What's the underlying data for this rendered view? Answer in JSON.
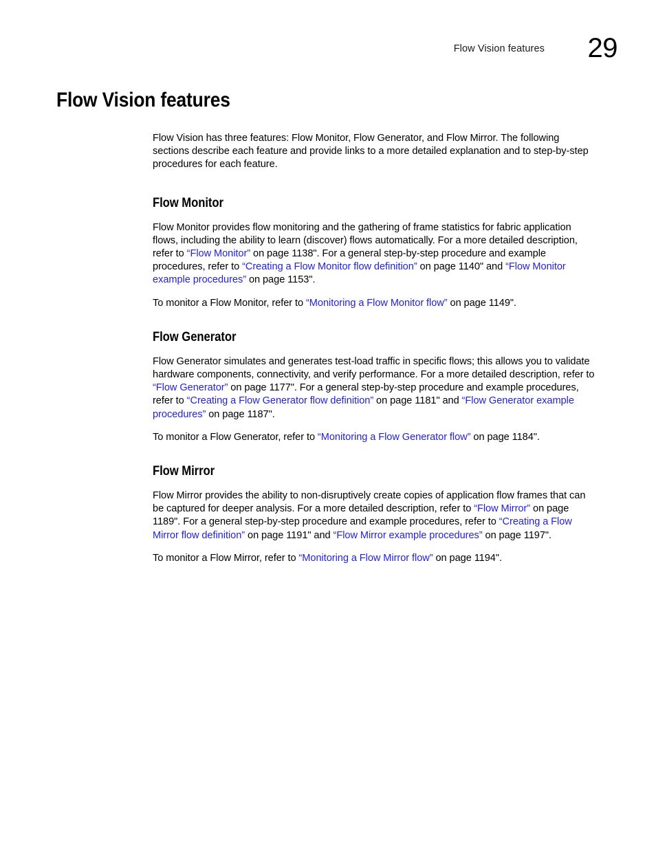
{
  "header": {
    "title": "Flow Vision features",
    "page_number": "29"
  },
  "colors": {
    "link": "#2222dd",
    "text": "#000000",
    "background": "#ffffff"
  },
  "chapter": {
    "title": "Flow Vision features",
    "intro": {
      "part1": "Flow Vision has three features: Flow Monitor, Flow Generator, and Flow Mirror. The following sections describe each feature and provide links to a more detailed explanation and to step-by-step procedures for each feature."
    }
  },
  "sections": [
    {
      "heading": "Flow Monitor",
      "paragraph1": {
        "t1": "Flow Monitor provides flow monitoring and the gathering of frame statistics for fabric application flows, including the ability to learn (discover) flows automatically. For a more detailed description, refer to ",
        "link1": "“Flow Monitor”",
        "t2": " on page 1138\".  For a general step-by-step procedure and example procedures, refer to ",
        "link2": "“Creating a Flow Monitor flow definition”",
        "t3": " on page 1140\" and ",
        "link3": "“Flow Monitor example procedures”",
        "t4": " on page 1153\"."
      },
      "paragraph2": {
        "t1": "To monitor a Flow Monitor, refer to ",
        "link1": "“Monitoring a Flow Monitor flow”",
        "t2": " on page 1149\"."
      }
    },
    {
      "heading": "Flow Generator",
      "paragraph1": {
        "t1": "Flow Generator simulates and generates test-load traffic in specific flows; this allows you to validate hardware components, connectivity, and verify performance. For a more detailed description, refer to ",
        "link1": "“Flow Generator”",
        "t2": " on page 1177\".  For a general step-by-step procedure and example procedures, refer to ",
        "link2": "“Creating a Flow Generator flow definition”",
        "t3": " on page 1181\" and ",
        "link3": "“Flow Generator example procedures”",
        "t4": " on page 1187\"."
      },
      "paragraph2": {
        "t1": "To monitor a Flow Generator, refer to ",
        "link1": "“Monitoring a Flow Generator flow”",
        "t2": " on page 1184\"."
      }
    },
    {
      "heading": "Flow Mirror",
      "paragraph1": {
        "t1": "Flow Mirror provides the ability to non-disruptively create copies of application flow frames that can be captured for deeper analysis. For a more detailed description, refer to ",
        "link1": "“Flow Mirror”",
        "t2": " on page 1189\". For a general step-by-step procedure and example procedures, refer to ",
        "link2": "“Creating a Flow Mirror flow definition”",
        "t3": " on page 1191\" and ",
        "link3": "“Flow Mirror example procedures”",
        "t4": " on page 1197\"."
      },
      "paragraph2": {
        "t1": "To monitor a Flow Mirror, refer to ",
        "link1": "“Monitoring a Flow Mirror flow”",
        "t2": " on page 1194\"."
      }
    }
  ]
}
